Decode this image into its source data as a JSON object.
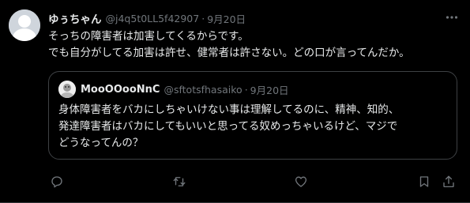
{
  "tweet": {
    "display_name": "ゆぅちゃん",
    "handle": "@j4q5t0LL5f42907",
    "separator": "·",
    "date": "9月20日",
    "lines": [
      "そっちの障害者は加害してくるからです。",
      "でも自分がしてる加害は許せ、健常者は許さない。どの口が言ってんだか。"
    ]
  },
  "quoted": {
    "display_name": "MooOOooNnC",
    "handle": "@sftotsfhasaiko",
    "separator": "·",
    "date": "9月20日",
    "lines": [
      "身体障害者をバカにしちゃいけない事は理解してるのに、精神、知的、",
      "発達障害者はバカにしてもいいと思ってる奴めっちゃいるけど、マジで",
      "どうなってんの？"
    ]
  },
  "actions": {
    "icons": [
      "reply-icon",
      "retweet-icon",
      "like-icon",
      "views-icon",
      "bookmark-icon",
      "share-icon"
    ]
  },
  "colors": {
    "background": "#000000",
    "text": "#e7e9ea",
    "muted": "#71767b",
    "border": "#3e4144"
  }
}
